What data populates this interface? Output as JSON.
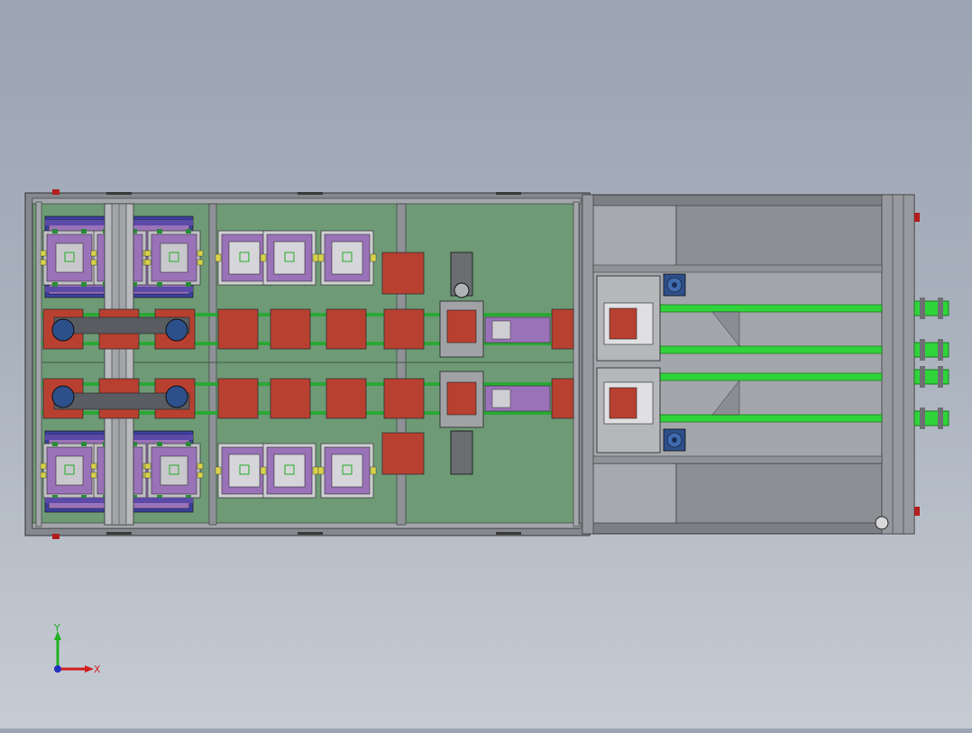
{
  "view": {
    "axis_triad": {
      "x_label": "X",
      "y_label": "Y"
    },
    "colors": {
      "background_top": "#9aa4b2",
      "background_bottom": "#c6ccd4",
      "frame": "#6e7278",
      "green_deck": "#6e9a76",
      "pad_red": "#b84030",
      "fixture_purple": "#9a72b8",
      "fixture_blue": "#3a3fa0",
      "rail_green": "#2fd33a",
      "gearbox_grey": "#a0a2a6",
      "motor_blue": "#2d4f8a"
    }
  }
}
